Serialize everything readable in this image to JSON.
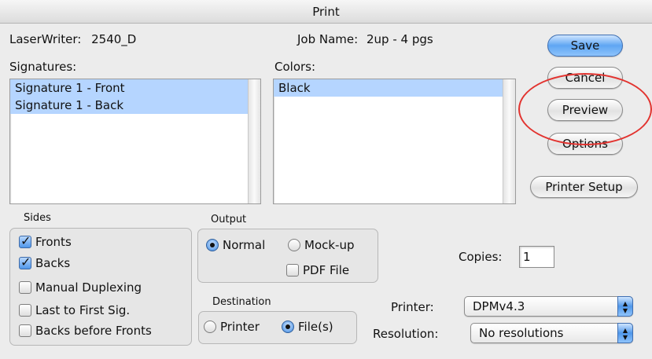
{
  "window": {
    "title": "Print"
  },
  "header": {
    "printer_label": "LaserWriter:",
    "printer_value": "2540_D",
    "job_label": "Job Name:",
    "job_value": "2up - 4 pgs"
  },
  "signatures": {
    "label": "Signatures:",
    "items": [
      "Signature 1 - Front",
      "Signature 1 - Back"
    ]
  },
  "colors": {
    "label": "Colors:",
    "items": [
      "Black"
    ]
  },
  "buttons": {
    "save": "Save",
    "cancel": "Cancel",
    "preview": "Preview",
    "options": "Options",
    "printer_setup": "Printer Setup"
  },
  "sides": {
    "title": "Sides",
    "options": [
      {
        "label": "Fronts",
        "checked": true
      },
      {
        "label": "Backs",
        "checked": true
      },
      {
        "label": "Manual Duplexing",
        "checked": false
      },
      {
        "label": "Last to First Sig.",
        "checked": false
      },
      {
        "label": "Backs before Fronts",
        "checked": false
      }
    ]
  },
  "output": {
    "title": "Output",
    "normal": "Normal",
    "mockup": "Mock-up",
    "pdf": "PDF File",
    "selected": "Normal"
  },
  "destination": {
    "title": "Destination",
    "printer": "Printer",
    "files": "File(s)",
    "selected": "File(s)"
  },
  "copies": {
    "label": "Copies:",
    "value": "1"
  },
  "printer_select": {
    "label": "Printer:",
    "value": "DPMv4.3"
  },
  "resolution_select": {
    "label": "Resolution:",
    "value": "No resolutions"
  },
  "colors_theme": {
    "selection": "#b5d5ff",
    "accent": "#4f97ea",
    "annotation": "#e2332f"
  }
}
